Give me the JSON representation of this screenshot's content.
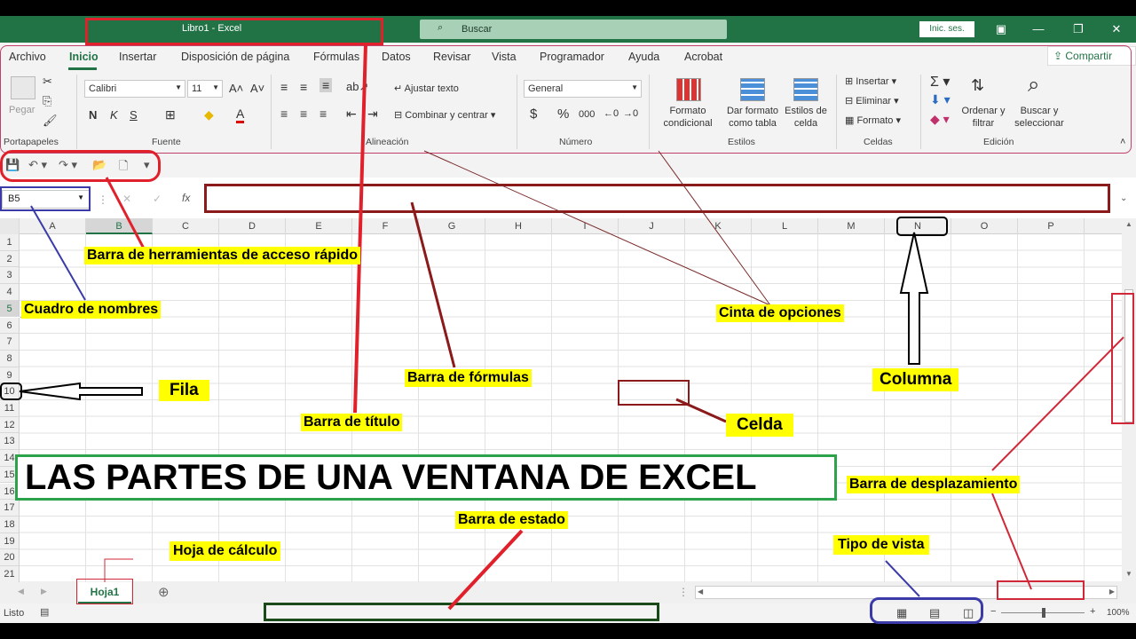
{
  "window": {
    "title": "Libro1  -  Excel",
    "search_placeholder": "Buscar",
    "signin": "Inic. ses."
  },
  "ribbon": {
    "tabs": [
      "Archivo",
      "Inicio",
      "Insertar",
      "Disposición de página",
      "Fórmulas",
      "Datos",
      "Revisar",
      "Vista",
      "Programador",
      "Ayuda",
      "Acrobat"
    ],
    "active_tab": "Inicio",
    "share": "Compartir",
    "clipboard": {
      "paste": "Pegar",
      "label": "Portapapeles"
    },
    "font": {
      "name": "Calibri",
      "size": "11",
      "bold": "N",
      "italic": "K",
      "underline": "S",
      "label": "Fuente"
    },
    "alignment": {
      "wrap": "Ajustar texto",
      "merge": "Combinar y centrar",
      "label": "Alineación"
    },
    "number": {
      "format": "General",
      "currency": "$",
      "percent": "%",
      "thousands": "000",
      "label": "Número"
    },
    "styles": {
      "conditional": "Formato condicional",
      "as_table": "Dar formato como tabla",
      "cell_styles": "Estilos de celda",
      "label": "Estilos"
    },
    "cells": {
      "insert": "Insertar",
      "delete": "Eliminar",
      "format": "Formato",
      "label": "Celdas"
    },
    "editing": {
      "sort": "Ordenar y filtrar",
      "find": "Buscar y seleccionar",
      "label": "Edición"
    }
  },
  "formula_bar": {
    "name_box": "B5",
    "fx": "fx",
    "value": ""
  },
  "grid": {
    "columns": [
      "A",
      "B",
      "C",
      "D",
      "E",
      "F",
      "G",
      "H",
      "I",
      "J",
      "K",
      "L",
      "M",
      "N",
      "O",
      "P"
    ],
    "rows": [
      "1",
      "2",
      "3",
      "4",
      "5",
      "6",
      "7",
      "8",
      "9",
      "10",
      "11",
      "12",
      "13",
      "14",
      "15",
      "16",
      "17",
      "18",
      "19",
      "20",
      "21"
    ],
    "selected_column": "B",
    "selected_row": "5"
  },
  "sheets": {
    "tabs": [
      "Hoja1"
    ],
    "active": "Hoja1"
  },
  "status": {
    "mode": "Listo",
    "zoom": "100%"
  },
  "annotations": {
    "main_title": "LAS PARTES DE UNA VENTANA DE EXCEL",
    "qat": "Barra de herramientas de acceso rápido",
    "namebox": "Cuadro de nombres",
    "ribbon": "Cinta de opciones",
    "formula": "Barra de fórmulas",
    "row": "Fila",
    "column": "Columna",
    "title": "Barra de título",
    "cell": "Celda",
    "scroll": "Barra de desplazamiento",
    "status": "Barra de estado",
    "sheet": "Hoja de cálculo",
    "view": "Tipo de vista"
  },
  "colors": {
    "excel_green": "#217346",
    "highlight": "#ffff00",
    "annot_red": "#e0202a",
    "annot_blue": "#3a3aa8",
    "annot_darkred": "#8b1a1a"
  }
}
